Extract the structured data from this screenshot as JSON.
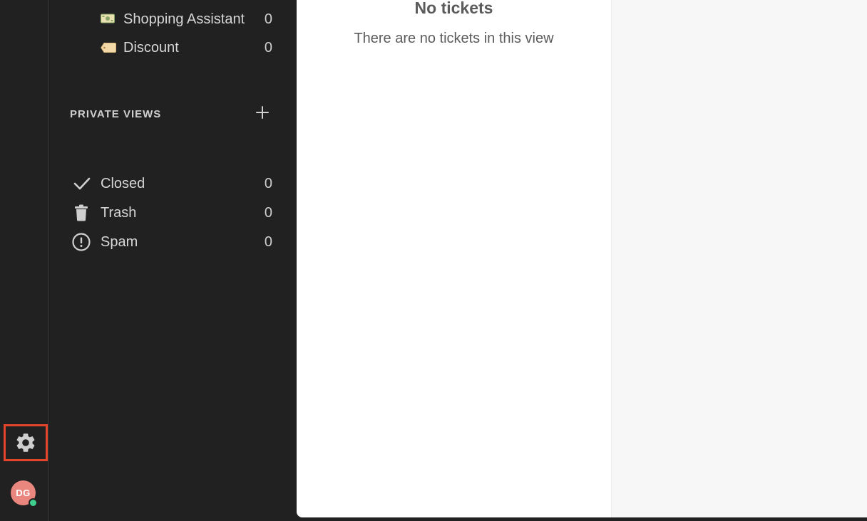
{
  "sidebar": {
    "views": [
      {
        "label": "Shopping Assistant",
        "count": "0",
        "icon": "cash-icon"
      },
      {
        "label": "Discount",
        "count": "0",
        "icon": "tag-icon"
      }
    ],
    "private_views": {
      "title": "PRIVATE VIEWS",
      "add_icon": "plus-icon"
    },
    "system_views": [
      {
        "label": "Closed",
        "count": "0",
        "icon": "check-icon"
      },
      {
        "label": "Trash",
        "count": "0",
        "icon": "trash-icon"
      },
      {
        "label": "Spam",
        "count": "0",
        "icon": "alert-circle-icon"
      }
    ]
  },
  "rail": {
    "settings_icon": "gear-icon",
    "avatar_initials": "DG",
    "status_color": "#3fcf8e",
    "highlight_color": "#e3452b"
  },
  "main": {
    "empty_title": "No tickets",
    "empty_subtitle": "There are no tickets in this view"
  }
}
